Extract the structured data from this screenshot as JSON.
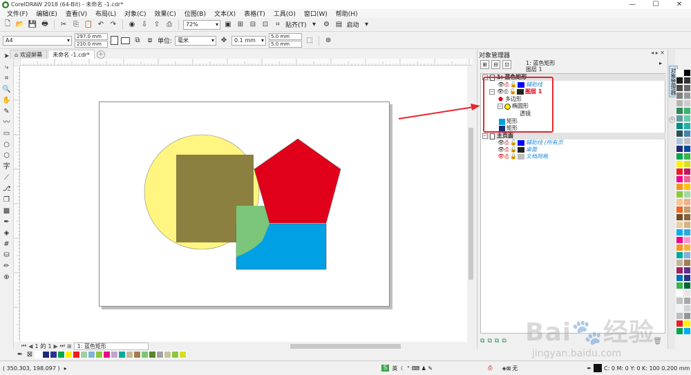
{
  "window": {
    "title": "CorelDRAW 2018 (64-Bit) - 未命名 -1.cdr*",
    "buttons": {
      "minimize": "—",
      "maximize": "☐",
      "close": "✕"
    }
  },
  "menu": [
    "文件(F)",
    "编辑(E)",
    "查看(V)",
    "布局(L)",
    "对象(C)",
    "效果(C)",
    "位图(B)",
    "文本(X)",
    "表格(T)",
    "工具(O)",
    "窗口(W)",
    "帮助(H)"
  ],
  "toolbar": {
    "zoom": "72%",
    "snap_label": "贴齐(T)",
    "launch_label": "启动"
  },
  "propbar": {
    "page_size": "A4",
    "width": "297.0 mm",
    "height": "210.0 mm",
    "units_label": "单位:",
    "units": "毫米",
    "nudge": "0.1 mm",
    "dup_x": "5.0 mm",
    "dup_y": "5.0 mm"
  },
  "tabs": [
    {
      "label": "欢迎屏幕",
      "active": false
    },
    {
      "label": "未命名 -1.cdr*",
      "active": true
    }
  ],
  "pagenav": {
    "current": "1",
    "of": "的",
    "total": "1",
    "page_tab": "1: 蓝色矩形"
  },
  "status": {
    "coords": "( 350.303, 198.097 )",
    "ime": "英",
    "fill_none": "无",
    "outline": "C: 0 M: 0 Y: 0 K: 100  0.200 mm"
  },
  "docker": {
    "title": "对象管理器",
    "selection_line1": "1: 蓝色矩形",
    "selection_line2": "图层 1",
    "vertical_tab": "对象管理器",
    "rows": [
      {
        "text": "1: 蓝色矩形",
        "style": "hdr"
      },
      {
        "text": "辅助线",
        "style": "italic-blue"
      },
      {
        "text": "图层 1",
        "style": "red-bold"
      },
      {
        "text": "多边形",
        "style": "normal"
      },
      {
        "text": "椭圆形",
        "style": "normal"
      },
      {
        "text": "透镜",
        "style": "normal"
      },
      {
        "text": "矩形",
        "style": "normal"
      },
      {
        "text": "矩形",
        "style": "normal"
      },
      {
        "text": "主页面",
        "style": "hdr"
      },
      {
        "text": "辅助线 (所有页",
        "style": "italic-blue"
      },
      {
        "text": "桌面",
        "style": "italic-blue"
      },
      {
        "text": "文档网格",
        "style": "italic-blue"
      }
    ]
  },
  "colors": {
    "circle": "#fff580",
    "lens_square": "#8b8040",
    "pentagon": "#e0001a",
    "blue_rect": "#00a0e4",
    "green_overlap": "#7bc67a",
    "callout": "#e8252e",
    "dark_blue_rect": "#1e2a78"
  },
  "watermark": {
    "brand": "Bai",
    "brand2": "经验",
    "url": "jingyan.baidu.com"
  },
  "palette_bottom": [
    "#ffffff",
    "#1e2a78",
    "#2e3192",
    "#00a651",
    "#fff200",
    "#ed1c24",
    "#a0d2a0",
    "#7fb2d8",
    "#8dc63f",
    "#ec008c",
    "#c1a5cc",
    "#00a99d",
    "#c8b89a",
    "#a67c52",
    "#7cc576",
    "#598527",
    "#a3a3a3",
    "#c6c3a1",
    "#8cc63f",
    "#d7df23"
  ],
  "palette_right": [
    "#ffffff",
    "#000000",
    "#1a1a1a",
    "#333333",
    "#4d4d4d",
    "#666666",
    "#808080",
    "#999999",
    "#b3b3b3",
    "#cccccc",
    "#2e8b57",
    "#3cb371",
    "#5f9ea0",
    "#66cdaa",
    "#008b8b",
    "#20b2aa",
    "#2f4f4f",
    "#4682b4",
    "#b0c4de",
    "#c0c0c0",
    "#1e2a78",
    "#0d47a1",
    "#00a651",
    "#39b54a",
    "#fff200",
    "#d7df23",
    "#ed1c24",
    "#c2185b",
    "#ec008c",
    "#f06292",
    "#f7941d",
    "#ffc20e",
    "#8dc63f",
    "#a3d9a5",
    "#fbc490",
    "#f9ad81",
    "#f26522",
    "#c69c6d",
    "#754c24",
    "#8c6239",
    "#e6cfa0",
    "#d4b483",
    "#00aeef",
    "#29abe2",
    "#ec008c",
    "#ff99cc",
    "#f7941d",
    "#fbb040",
    "#00a99d",
    "#7fb2d8",
    "#c7b299",
    "#a67c52",
    "#9e1f63",
    "#662d91",
    "#0072bc",
    "#2e3192",
    "#39b54a",
    "#006837",
    "#ffffff",
    "#e6e6e6",
    "#c1c1c1",
    "#a8a8a8",
    "#f1f2f2",
    "#d1d3d4",
    "#bcbec0",
    "#939598",
    "#ed1c24",
    "#fff200",
    "#00a651",
    "#00aeef"
  ]
}
